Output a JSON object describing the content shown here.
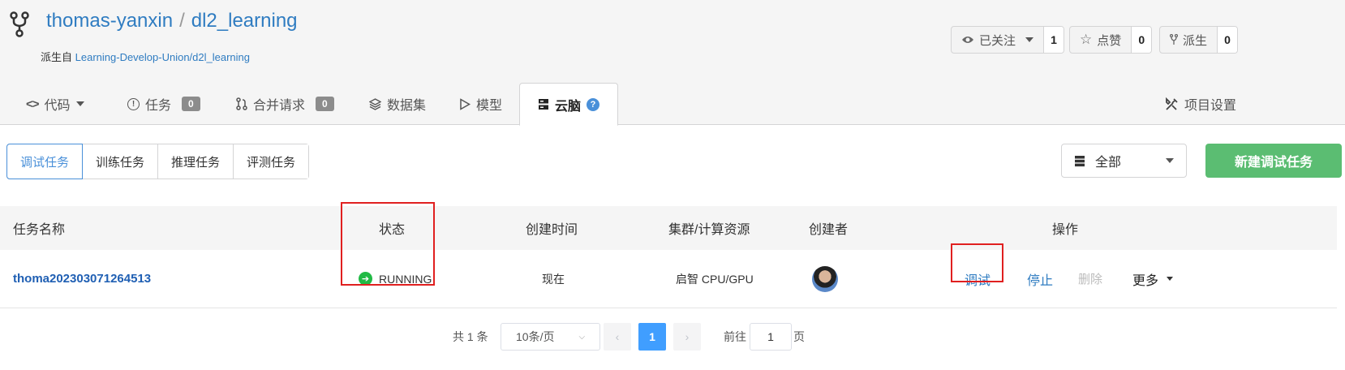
{
  "repo": {
    "owner": "thomas-yanxin",
    "separator": "/",
    "name": "dl2_learning",
    "forked_label": "派生自",
    "forked_from": "Learning-Develop-Union/d2l_learning"
  },
  "actions": {
    "watch_label": "已关注",
    "watch_count": "1",
    "star_label": "点赞",
    "star_count": "0",
    "fork_label": "派生",
    "fork_count": "0"
  },
  "tabs": {
    "code": "代码",
    "issues": "任务",
    "issues_count": "0",
    "pulls": "合并请求",
    "pulls_count": "0",
    "datasets": "数据集",
    "models": "模型",
    "cloudbrain": "云脑",
    "help": "?",
    "settings": "项目设置"
  },
  "subtabs": [
    "调试任务",
    "训练任务",
    "推理任务",
    "评测任务"
  ],
  "filter": {
    "value": "全部"
  },
  "new_button": "新建调试任务",
  "table": {
    "headers": {
      "name": "任务名称",
      "status": "状态",
      "created": "创建时间",
      "cluster": "集群/计算资源",
      "creator": "创建者",
      "ops": "操作"
    },
    "rows": [
      {
        "name": "thoma202303071264513",
        "status": "RUNNING",
        "created": "现在",
        "cluster": "启智 CPU/GPU",
        "ops": {
          "debug": "调试",
          "stop": "停止",
          "delete": "删除",
          "more": "更多"
        }
      }
    ]
  },
  "pager": {
    "total": "共 1 条",
    "page_size": "10条/页",
    "current": "1",
    "goto_label": "前往",
    "goto_value": "1",
    "goto_unit": "页"
  },
  "colors": {
    "link": "#2f7cc1",
    "primary_green": "#5bbd72",
    "running_green": "#21ba45",
    "highlight_red": "#e02020",
    "pager_active": "#409eff"
  }
}
